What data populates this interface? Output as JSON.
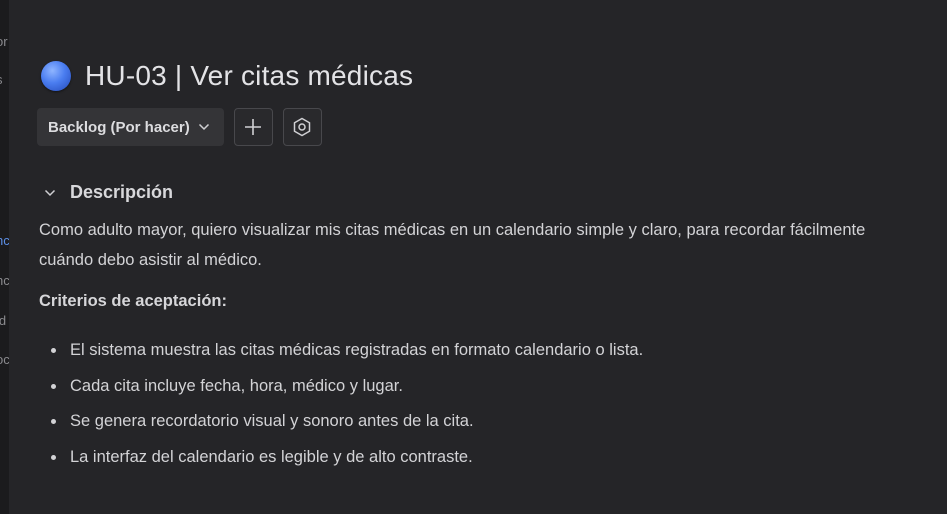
{
  "left_fragments": [
    "or",
    "s",
    "nc",
    "nc",
    "ld",
    "oc"
  ],
  "issue": {
    "title": "HU-03 | Ver citas médicas",
    "icon": "blue-sphere-icon"
  },
  "toolbar": {
    "status_label": "Backlog (Por hacer)",
    "add_icon": "plus-icon",
    "settings_icon": "hexagon-settings-icon"
  },
  "description": {
    "heading": "Descripción",
    "text": "Como adulto mayor, quiero visualizar mis citas médicas en un calendario simple y claro, para recordar fácilmente cuándo debo asistir al médico.",
    "criteria_heading": "Criterios de aceptación:",
    "criteria": [
      "El sistema muestra las citas médicas registradas en formato calendario o lista.",
      "Cada cita incluye fecha, hora, médico y lugar.",
      "Se genera recordatorio visual y sonoro antes de la cita.",
      "La interfaz del calendario es legible y de alto contraste."
    ]
  },
  "colors": {
    "background": "#252528",
    "accent": "#4a7df0",
    "text": "#d3d3d6"
  }
}
